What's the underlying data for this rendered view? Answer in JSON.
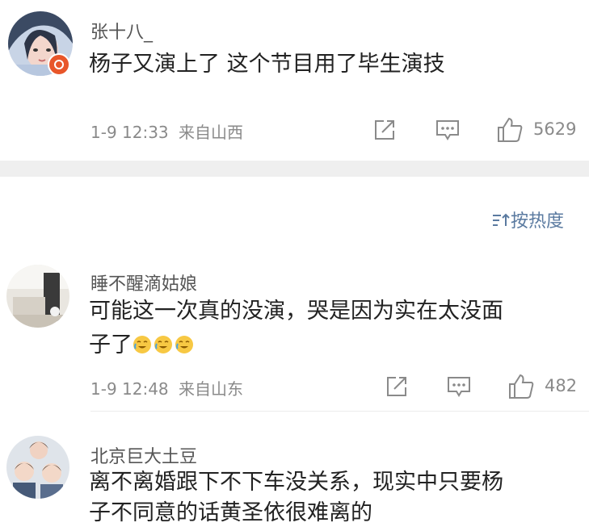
{
  "comments": [
    {
      "username": "张十八_",
      "text": "杨子又演上了 这个节目用了毕生演技",
      "time": "1-9 12:33",
      "location": "来自山西",
      "likes": "5629",
      "icons": [
        "share-icon",
        "comment-icon",
        "like-icon"
      ],
      "badge": "verified-badge-icon"
    },
    {
      "username": "睡不醒滴姑娘",
      "text_line1": "可能这一次真的没演，哭是因为实在太没面",
      "text_line2": "子了",
      "emojis": [
        "laugh-cry-emoji",
        "laugh-cry-emoji",
        "laugh-cry-emoji"
      ],
      "time": "1-9 12:48",
      "location": "来自山东",
      "likes": "482",
      "icons": [
        "share-icon",
        "comment-icon",
        "like-icon"
      ]
    },
    {
      "username": "北京巨大土豆",
      "text_line1": "离不离婚跟下不下车没关系，现实中只要杨",
      "text_line2": "子不同意的话黄圣依很难离的"
    }
  ],
  "sort": {
    "icon": "sort-icon",
    "label": "按热度"
  },
  "colors": {
    "accent": "#5a7aa0",
    "meta": "#8a8a8a",
    "band": "#efefef",
    "badge": "#e8562a"
  }
}
